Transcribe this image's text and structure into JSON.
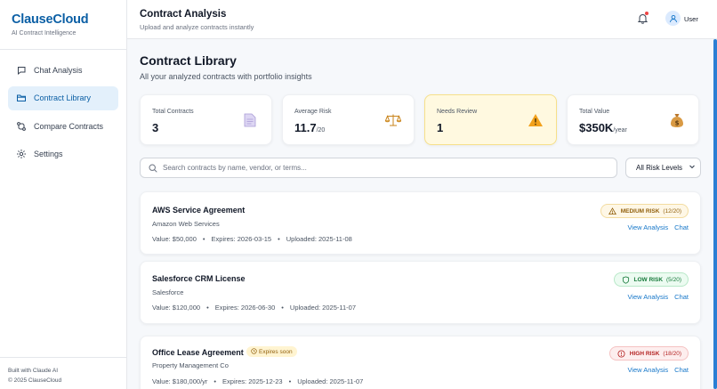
{
  "sidebar": {
    "brand": "ClauseCloud",
    "tagline": "AI Contract Intelligence",
    "items": [
      {
        "label": "Chat Analysis",
        "icon": "chat-icon",
        "active": false
      },
      {
        "label": "Contract Library",
        "icon": "folder-icon",
        "active": true
      },
      {
        "label": "Compare Contracts",
        "icon": "compare-icon",
        "active": false
      },
      {
        "label": "Settings",
        "icon": "gear-icon",
        "active": false
      }
    ],
    "footer_line1": "Built with Claude AI",
    "footer_line2": "© 2025 ClauseCloud"
  },
  "header": {
    "title": "Contract Analysis",
    "subtitle": "Upload and analyze contracts instantly",
    "user_label": "User"
  },
  "main": {
    "title": "Contract Library",
    "subtitle": "All your analyzed contracts with portfolio insights",
    "stats": [
      {
        "label": "Total Contracts",
        "value": "3",
        "unit": "",
        "icon": "document-icon"
      },
      {
        "label": "Average Risk",
        "value": "11.7",
        "unit": "/20",
        "icon": "scales-icon"
      },
      {
        "label": "Needs Review",
        "value": "1",
        "unit": "",
        "icon": "warning-icon"
      },
      {
        "label": "Total Value",
        "value": "$350K",
        "unit": "/year",
        "icon": "money-bag-icon"
      }
    ],
    "search_placeholder": "Search contracts by name, vendor, or terms...",
    "filter_value": "All Risk Levels",
    "contracts": [
      {
        "name": "AWS Service Agreement",
        "vendor": "Amazon Web Services",
        "value": "Value: $50,000",
        "expires": "Expires: 2026-03-15",
        "uploaded": "Uploaded: 2025-11-08",
        "risk_label": "MEDIUM RISK",
        "risk_score": "(12/20)",
        "risk_level": "medium",
        "expiring_tag": ""
      },
      {
        "name": "Salesforce CRM License",
        "vendor": "Salesforce",
        "value": "Value: $120,000",
        "expires": "Expires: 2026-06-30",
        "uploaded": "Uploaded: 2025-11-07",
        "risk_label": "LOW RISK",
        "risk_score": "(5/20)",
        "risk_level": "low",
        "expiring_tag": ""
      },
      {
        "name": "Office Lease Agreement",
        "vendor": "Property Management Co",
        "value": "Value: $180,000/yr",
        "expires": "Expires: 2025-12-23",
        "uploaded": "Uploaded: 2025-11-07",
        "risk_label": "HIGH RISK",
        "risk_score": "(18/20)",
        "risk_level": "high",
        "expiring_tag": "Expires soon"
      }
    ],
    "view_analysis_label": "View Analysis",
    "chat_label": "Chat"
  },
  "colors": {
    "brand": "#0b5fa5",
    "link": "#1677c9",
    "medium_risk": "#92610e",
    "low_risk": "#167a3a",
    "high_risk": "#b42323"
  }
}
